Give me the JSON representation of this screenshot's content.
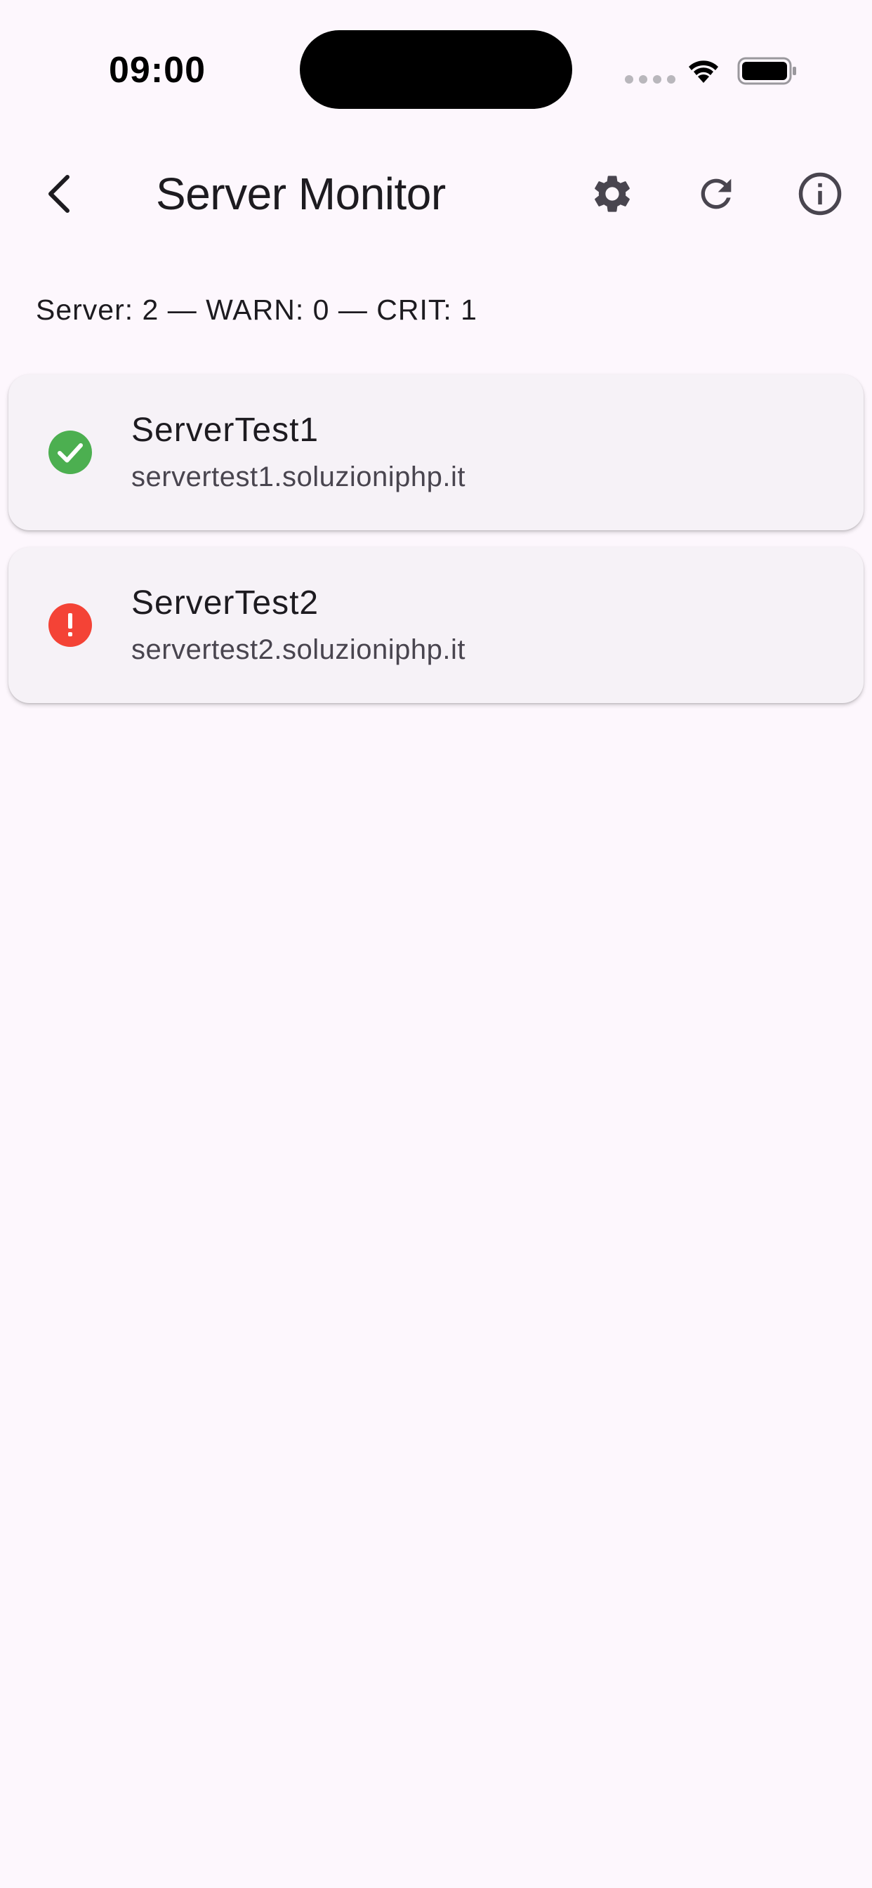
{
  "status_bar": {
    "time": "09:00"
  },
  "app_bar": {
    "title": "Server Monitor",
    "icons": {
      "back": "chevron-left-icon",
      "settings": "gear-icon",
      "refresh": "refresh-icon",
      "info": "info-icon"
    }
  },
  "summary": {
    "text": "Server: 2 — WARN: 0 — CRIT: 1"
  },
  "servers": [
    {
      "name": "ServerTest1",
      "host": "servertest1.soluzioniphp.it",
      "status": "ok",
      "status_icon": "check-circle-icon",
      "status_color": "#4caf50"
    },
    {
      "name": "ServerTest2",
      "host": "servertest2.soluzioniphp.it",
      "status": "critical",
      "status_icon": "error-icon",
      "status_color": "#f44336"
    }
  ],
  "colors": {
    "background": "#fdf7fd",
    "card": "#f6f2f7",
    "text_primary": "#1d1b20",
    "text_secondary": "#49454f",
    "ok": "#4caf50",
    "critical": "#f44336"
  }
}
